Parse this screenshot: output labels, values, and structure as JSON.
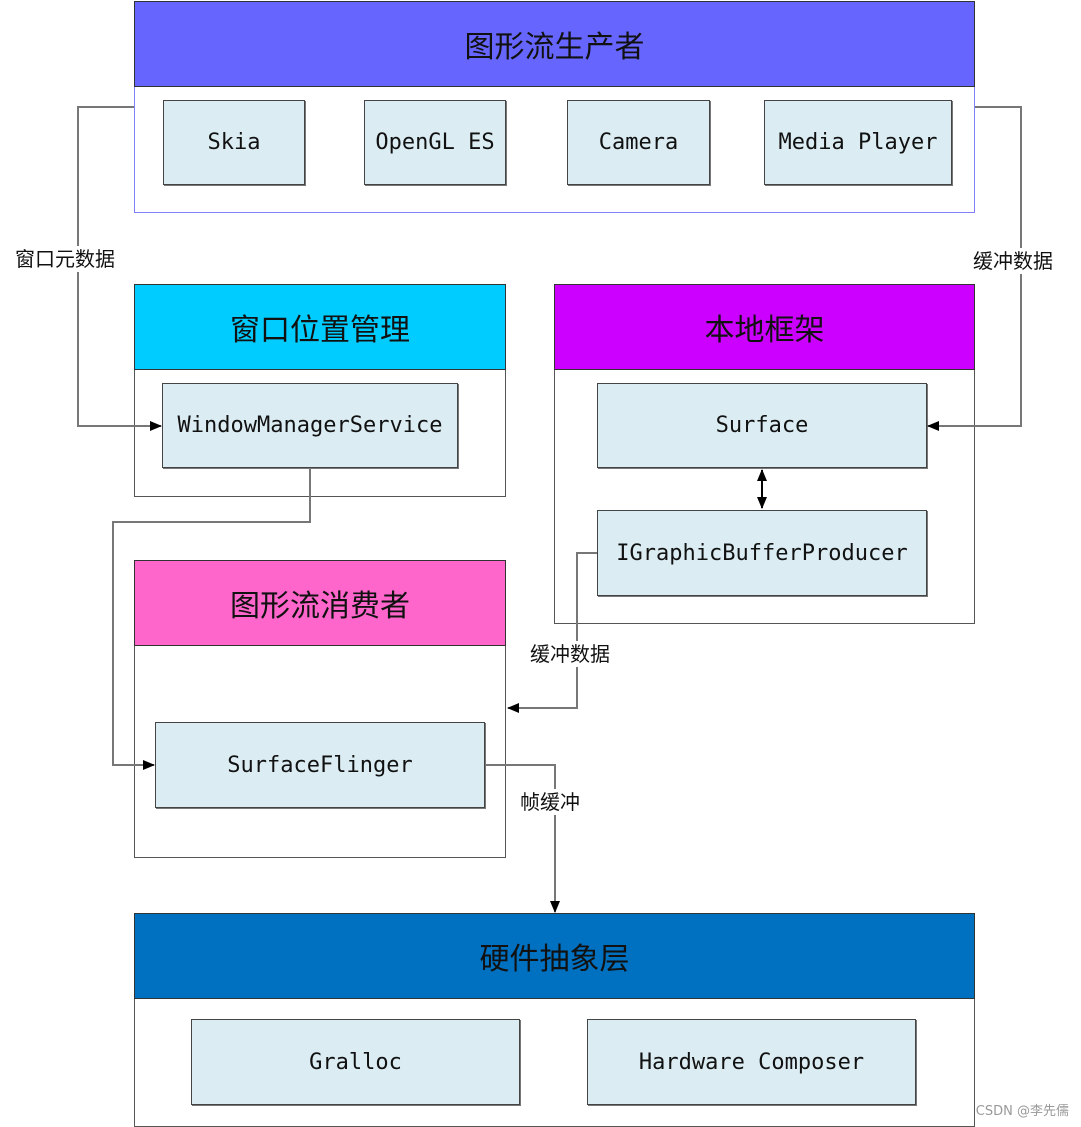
{
  "groups": {
    "producer": {
      "title": "图形流生产者",
      "color": "#6666ff",
      "items": [
        "Skia",
        "OpenGL ES",
        "Camera",
        "Media Player"
      ]
    },
    "window": {
      "title": "窗口位置管理",
      "color": "#00ccff",
      "items": [
        "WindowManagerService"
      ]
    },
    "native": {
      "title": "本地框架",
      "color": "#cc00ff",
      "items": [
        "Surface",
        "IGraphicBufferProducer"
      ]
    },
    "consumer": {
      "title": "图形流消费者",
      "color": "#ff66cc",
      "items": [
        "SurfaceFlinger"
      ]
    },
    "hal": {
      "title": "硬件抽象层",
      "color": "#0070c0",
      "items": [
        "Gralloc",
        "Hardware Composer"
      ]
    }
  },
  "edges": {
    "window_metadata": "窗口元数据",
    "buffer_data_right": "缓冲数据",
    "buffer_data_mid": "缓冲数据",
    "frame_buffer": "帧缓冲"
  },
  "node_fill": "#dbedf3",
  "watermark": "CSDN @李先儒"
}
